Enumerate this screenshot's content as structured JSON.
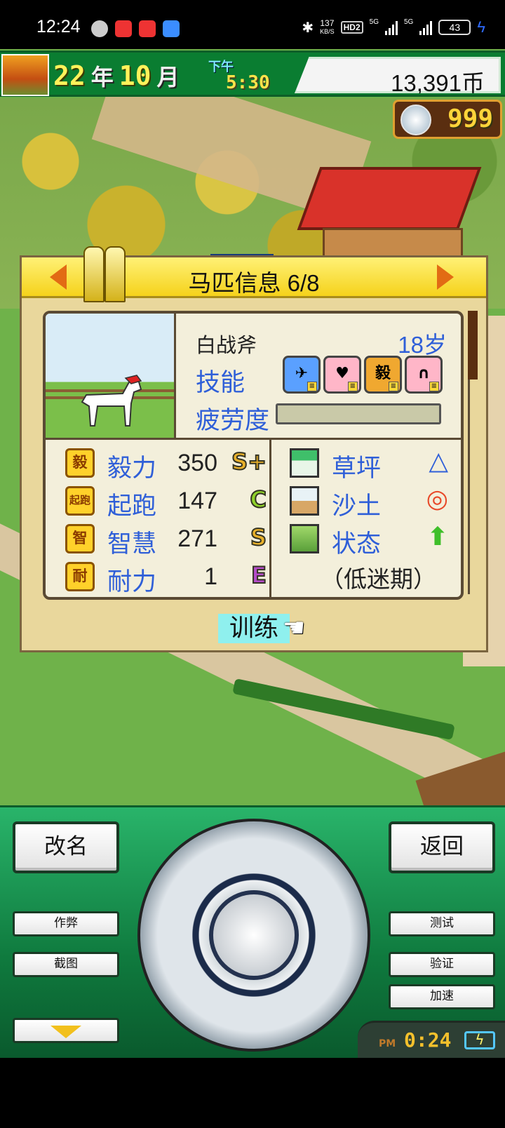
{
  "status_bar": {
    "time": "12:24",
    "net_speed_value": "137",
    "net_speed_unit": "KB/S",
    "hd_badge": "HD2",
    "sig1": "5G",
    "sig2": "5G",
    "battery": "43"
  },
  "hud": {
    "year": "22",
    "year_unit": "年",
    "month": "10",
    "month_unit": "月",
    "ampm": "下午",
    "clock": "5:30",
    "money": "13,391币",
    "medals": "999"
  },
  "panel": {
    "title": "马匹信息 6/8",
    "horse_name": "白战斧",
    "age": "18岁",
    "skill_label": "技能",
    "skills": [
      {
        "icon": "rocket-skill-icon",
        "color": "#5aa0ff",
        "glyph": "✈"
      },
      {
        "icon": "heart-skill-icon",
        "color": "#ffb6c8",
        "glyph": "♥"
      },
      {
        "icon": "yili-skill-icon",
        "color": "#f0a830",
        "glyph": "毅"
      },
      {
        "icon": "horseshoe-skill-icon",
        "color": "#ffb6c8",
        "glyph": "∩"
      }
    ],
    "fatigue_label": "疲劳度",
    "stats": [
      {
        "badge": "毅",
        "label": "毅力",
        "value": "350",
        "grade": "S+",
        "grade_color": "#e8b02a"
      },
      {
        "badge": "起跑",
        "label": "起跑",
        "value": "147",
        "grade": "C",
        "grade_color": "#8fd12a"
      },
      {
        "badge": "智",
        "label": "智慧",
        "value": "271",
        "grade": "S",
        "grade_color": "#e8b02a"
      },
      {
        "badge": "耐",
        "label": "耐力",
        "value": "1",
        "grade": "E",
        "grade_color": "#b44cc8"
      }
    ],
    "aptitude": [
      {
        "label": "草坪",
        "mark": "△",
        "mark_color": "#2f5fd8"
      },
      {
        "label": "沙土",
        "mark": "◎",
        "mark_color": "#e84a2a"
      },
      {
        "label": "状态",
        "mark": "⬆",
        "mark_color": "#3fbf2a"
      }
    ],
    "condition": "（低迷期）",
    "train_button": "训练"
  },
  "controller": {
    "rename": "改名",
    "back": "返回",
    "cheat": "作弊",
    "screenshot": "截图",
    "test": "测试",
    "verify": "验证",
    "speedup": "加速",
    "pm": "PM",
    "clock": "0:24"
  }
}
